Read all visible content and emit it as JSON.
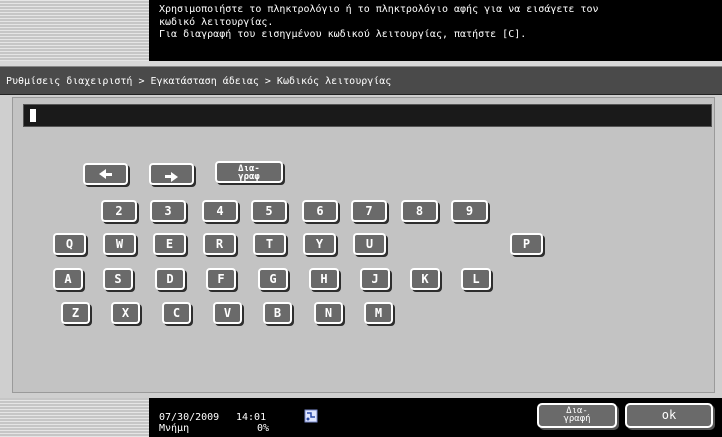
{
  "instructions": {
    "line1": "Χρησιμοποιήστε το πληκτρολόγιο ή το πληκτρολόγιο αφής για να εισάγετε τον",
    "line2": "κωδικό λειτουργίας.",
    "line3": "Για διαγραφή του εισηγμένου κωδικού λειτουργίας, πατήστε [C]."
  },
  "breadcrumb": "Ρυθμίσεις διαχειριστή > Εγκατάσταση άδειας > Κωδικός λειτουργίας",
  "input": {
    "value": ""
  },
  "keyboard": {
    "left_arrow_icon": "left-arrow-icon",
    "right_arrow_icon": "right-arrow-icon",
    "delete_label_line1": "Δια-",
    "delete_label_line2": "γραφ",
    "numbers": [
      "2",
      "3",
      "4",
      "5",
      "6",
      "7",
      "8",
      "9"
    ],
    "row_q": [
      "Q",
      "W",
      "E",
      "R",
      "T",
      "Y",
      "U",
      "P"
    ],
    "row_a": [
      "A",
      "S",
      "D",
      "F",
      "G",
      "H",
      "J",
      "K",
      "L"
    ],
    "row_z": [
      "Z",
      "X",
      "C",
      "V",
      "B",
      "N",
      "M"
    ]
  },
  "status": {
    "date": "07/30/2009",
    "time": "14:01",
    "memory_label": "Μνήμη",
    "memory_value": "0%",
    "icon": "network-status-icon"
  },
  "buttons": {
    "delete_line1": "Δια-",
    "delete_line2": "γραφή",
    "ok": "ok"
  },
  "colors": {
    "key_fill": "#6a6a6a",
    "panel_bg": "#c3c3c3",
    "header_bg": "#000000",
    "breadcrumb_bg": "#4a4a4a"
  }
}
